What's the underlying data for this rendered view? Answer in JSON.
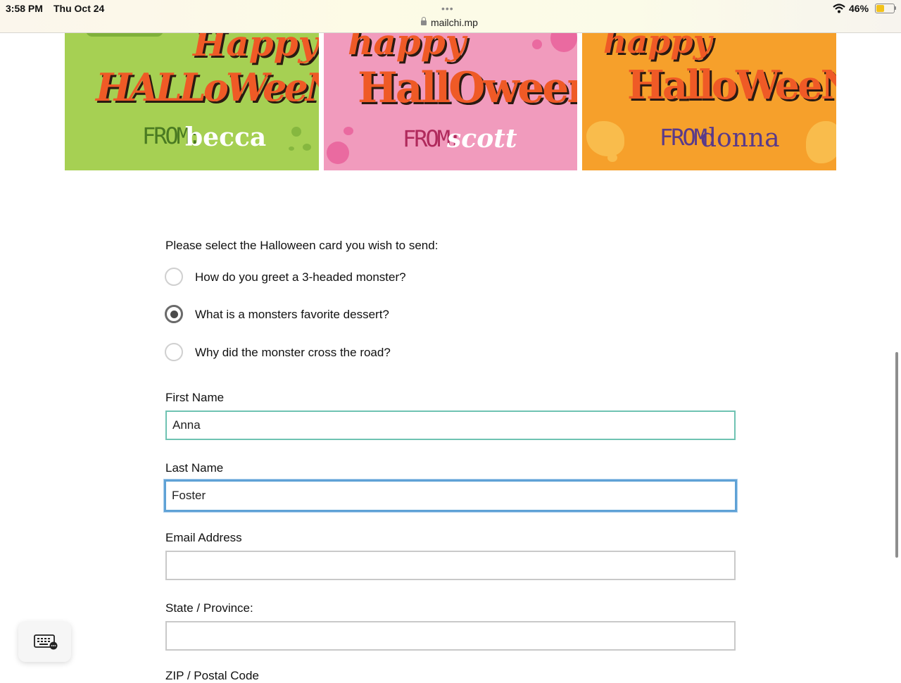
{
  "status_bar": {
    "time": "3:58 PM",
    "date": "Thu Oct 24",
    "dots": "•••",
    "url": "mailchi.mp",
    "battery": "46%",
    "battery_level": 0.46
  },
  "cards": [
    {
      "line1": "Happy",
      "line2": "HALLoWeeN",
      "from": "FROM:",
      "name": "becca",
      "bg_color": "#a6d053"
    },
    {
      "line1": "happy",
      "line2": "HallOween",
      "from": "FROM:",
      "name": "scott",
      "bg_color": "#f19bbd"
    },
    {
      "line1": "happy",
      "line2": "HalloWeeN",
      "from": "FROM:",
      "name": "donna",
      "bg_color": "#f6a02b"
    }
  ],
  "form": {
    "prompt": "Please select the Halloween card you wish to send:",
    "options": [
      {
        "label": "How do you greet a 3-headed monster?",
        "selected": false
      },
      {
        "label": "What is a monsters favorite dessert?",
        "selected": true
      },
      {
        "label": "Why did the monster cross the road?",
        "selected": false
      }
    ],
    "first_name": {
      "label": "First Name",
      "value": "Anna"
    },
    "last_name": {
      "label": "Last Name",
      "value": "Foster"
    },
    "email": {
      "label": "Email Address",
      "value": ""
    },
    "state": {
      "label": "State / Province:",
      "value": ""
    },
    "zip_label": "ZIP / Postal Code"
  },
  "colors": {
    "accent_orange": "#ef5a26",
    "focus_blue": "#5fa2d6",
    "field_green": "#6fc3b2"
  },
  "icons": {
    "keyboard": "keyboard-icon",
    "wifi": "wifi-icon",
    "lock": "lock-icon",
    "battery": "battery-icon"
  }
}
